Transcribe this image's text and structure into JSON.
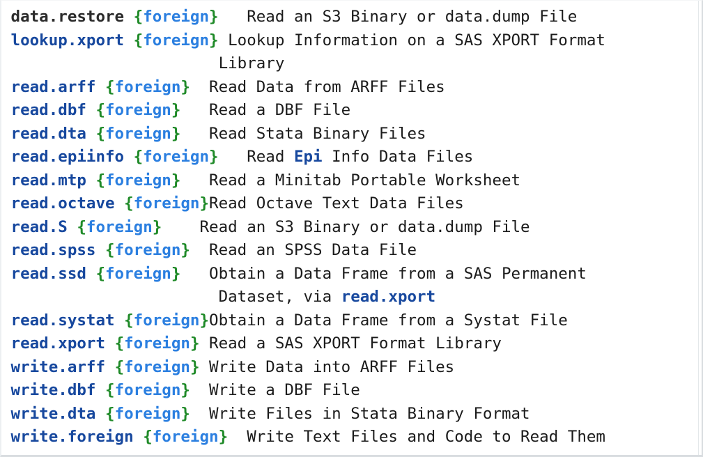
{
  "page": {
    "kind": "r-help-index",
    "package": "foreign",
    "colors": {
      "topic_link": "#17489e",
      "topic_visited": "#2b2b2b",
      "brace": "#1f8a28",
      "package_name": "#2b7fe0",
      "body_text": "#1b1b1b",
      "background": "#ffffff",
      "border": "#d9dde0"
    },
    "left_pad_chars": 12,
    "brace_open": "{",
    "brace_close": "}"
  },
  "entries": [
    {
      "topic": "data.restore",
      "package": "foreign",
      "visited": true,
      "gap": "   ",
      "title_parts": [
        {
          "text": "Read an S3 Binary or data.dump File",
          "link": false
        }
      ],
      "cont_lines": []
    },
    {
      "topic": "lookup.xport",
      "package": "foreign",
      "visited": false,
      "gap": " ",
      "title_parts": [
        {
          "text": "Lookup Information on a SAS XPORT Format",
          "link": false
        }
      ],
      "cont_lines": [
        {
          "indent": "                      ",
          "parts": [
            {
              "text": "Library",
              "link": false
            }
          ]
        }
      ]
    },
    {
      "topic": "read.arff",
      "package": "foreign",
      "visited": false,
      "gap": "  ",
      "title_parts": [
        {
          "text": "Read Data from ARFF Files",
          "link": false
        }
      ],
      "cont_lines": []
    },
    {
      "topic": "read.dbf",
      "package": "foreign",
      "visited": false,
      "gap": "   ",
      "title_parts": [
        {
          "text": "Read a DBF File",
          "link": false
        }
      ],
      "cont_lines": []
    },
    {
      "topic": "read.dta",
      "package": "foreign",
      "visited": false,
      "gap": "   ",
      "title_parts": [
        {
          "text": "Read Stata Binary Files",
          "link": false
        }
      ],
      "cont_lines": []
    },
    {
      "topic": "read.epiinfo",
      "package": "foreign",
      "visited": false,
      "gap": "   ",
      "title_parts": [
        {
          "text": "Read ",
          "link": false
        },
        {
          "text": "Epi",
          "link": true
        },
        {
          "text": " Info Data Files",
          "link": false
        }
      ],
      "cont_lines": []
    },
    {
      "topic": "read.mtp",
      "package": "foreign",
      "visited": false,
      "gap": "   ",
      "title_parts": [
        {
          "text": "Read a Minitab Portable Worksheet",
          "link": false
        }
      ],
      "cont_lines": []
    },
    {
      "topic": "read.octave",
      "package": "foreign",
      "visited": false,
      "gap": "",
      "title_parts": [
        {
          "text": "Read Octave Text Data Files",
          "link": false
        }
      ],
      "cont_lines": []
    },
    {
      "topic": "read.S",
      "package": "foreign",
      "visited": false,
      "gap": "    ",
      "title_parts": [
        {
          "text": "Read an S3 Binary or data.dump File",
          "link": false
        }
      ],
      "cont_lines": []
    },
    {
      "topic": "read.spss",
      "package": "foreign",
      "visited": false,
      "gap": "  ",
      "title_parts": [
        {
          "text": "Read an SPSS Data File",
          "link": false
        }
      ],
      "cont_lines": []
    },
    {
      "topic": "read.ssd",
      "package": "foreign",
      "visited": false,
      "gap": "   ",
      "title_parts": [
        {
          "text": "Obtain a Data Frame from a SAS Permanent",
          "link": false
        }
      ],
      "cont_lines": [
        {
          "indent": "                      ",
          "parts": [
            {
              "text": "Dataset, via ",
              "link": false
            },
            {
              "text": "read.xport",
              "link": true
            }
          ]
        }
      ]
    },
    {
      "topic": "read.systat",
      "package": "foreign",
      "visited": false,
      "gap": "",
      "title_parts": [
        {
          "text": "Obtain a Data Frame from a Systat File",
          "link": false
        }
      ],
      "cont_lines": []
    },
    {
      "topic": "read.xport",
      "package": "foreign",
      "visited": false,
      "gap": " ",
      "title_parts": [
        {
          "text": "Read a SAS XPORT Format Library",
          "link": false
        }
      ],
      "cont_lines": []
    },
    {
      "topic": "write.arff",
      "package": "foreign",
      "visited": false,
      "gap": " ",
      "title_parts": [
        {
          "text": "Write Data into ARFF Files",
          "link": false
        }
      ],
      "cont_lines": []
    },
    {
      "topic": "write.dbf",
      "package": "foreign",
      "visited": false,
      "gap": "  ",
      "title_parts": [
        {
          "text": "Write a DBF File",
          "link": false
        }
      ],
      "cont_lines": []
    },
    {
      "topic": "write.dta",
      "package": "foreign",
      "visited": false,
      "gap": "  ",
      "title_parts": [
        {
          "text": "Write Files in Stata Binary Format",
          "link": false
        }
      ],
      "cont_lines": []
    },
    {
      "topic": "write.foreign",
      "package": "foreign",
      "visited": false,
      "gap": "  ",
      "title_parts": [
        {
          "text": "Write Text Files and Code to Read Them",
          "link": false
        }
      ],
      "cont_lines": []
    }
  ]
}
